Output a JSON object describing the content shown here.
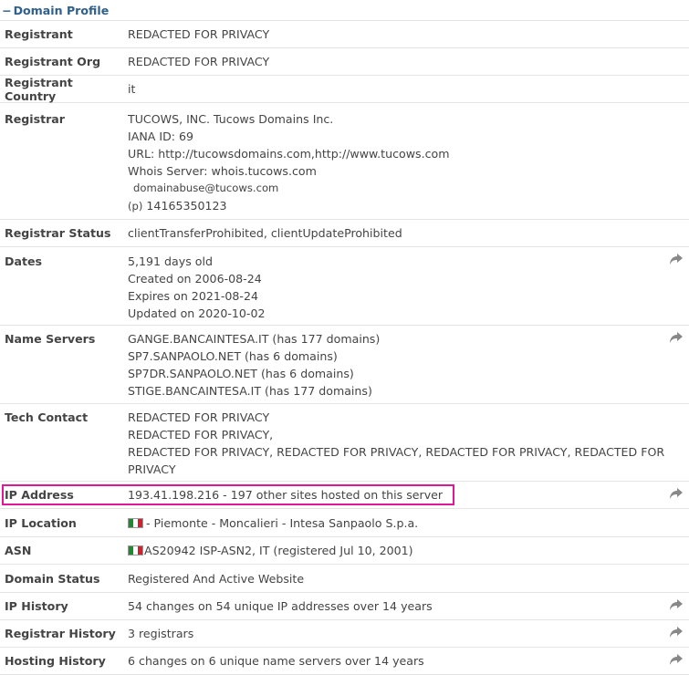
{
  "header": {
    "toggle": "−",
    "title": "Domain Profile"
  },
  "rows": {
    "registrant": {
      "label": "Registrant",
      "value": "REDACTED FOR PRIVACY"
    },
    "registrant_org": {
      "label": "Registrant Org",
      "value": "REDACTED FOR PRIVACY"
    },
    "registrant_country": {
      "label": "Registrant Country",
      "value": "it"
    },
    "registrar": {
      "label": "Registrar",
      "name": "TUCOWS, INC. Tucows Domains Inc.",
      "iana": "IANA ID: 69",
      "url": "URL: http://tucowsdomains.com,http://www.tucows.com",
      "whois": "Whois Server: whois.tucows.com",
      "email": "domainabuse@tucows.com",
      "phone_prefix": "(p)",
      "phone": "14165350123"
    },
    "registrar_status": {
      "label": "Registrar Status",
      "value": "clientTransferProhibited, clientUpdateProhibited"
    },
    "dates": {
      "label": "Dates",
      "age": "5,191 days old",
      "created": "Created on 2006-08-24",
      "expires": "Expires on 2021-08-24",
      "updated": "Updated on 2020-10-02"
    },
    "name_servers": {
      "label": "Name Servers",
      "items": [
        "GANGE.BANCAINTESA.IT (has 177 domains)",
        "SP7.SANPAOLO.NET (has 6 domains)",
        "SP7DR.SANPAOLO.NET (has 6 domains)",
        "STIGE.BANCAINTESA.IT (has 177 domains)"
      ]
    },
    "tech_contact": {
      "label": "Tech Contact",
      "line1": "REDACTED FOR PRIVACY",
      "line2": "REDACTED FOR PRIVACY,",
      "line3": "REDACTED FOR PRIVACY, REDACTED FOR PRIVACY, REDACTED FOR PRIVACY, REDACTED FOR PRIVACY"
    },
    "ip_address": {
      "label": "IP Address",
      "value": "193.41.198.216 - 197 other sites hosted on this server"
    },
    "ip_location": {
      "label": "IP Location",
      "value": "- Piemonte - Moncalieri - Intesa Sanpaolo S.p.a."
    },
    "asn": {
      "label": "ASN",
      "value": "AS20942 ISP-ASN2, IT (registered Jul 10, 2001)"
    },
    "domain_status": {
      "label": "Domain Status",
      "value": "Registered And Active Website"
    },
    "ip_history": {
      "label": "IP History",
      "value": "54 changes on 54 unique IP addresses over 14 years"
    },
    "registrar_history": {
      "label": "Registrar History",
      "value": "3 registrars"
    },
    "hosting_history": {
      "label": "Hosting History",
      "value": "6 changes on 6 unique name servers over 14 years"
    }
  },
  "icons": {
    "share": "share-arrow-icon",
    "flag": "italy-flag-icon"
  },
  "colors": {
    "header": "#2f5f8a",
    "highlight": "#e01796",
    "text": "#444444"
  }
}
